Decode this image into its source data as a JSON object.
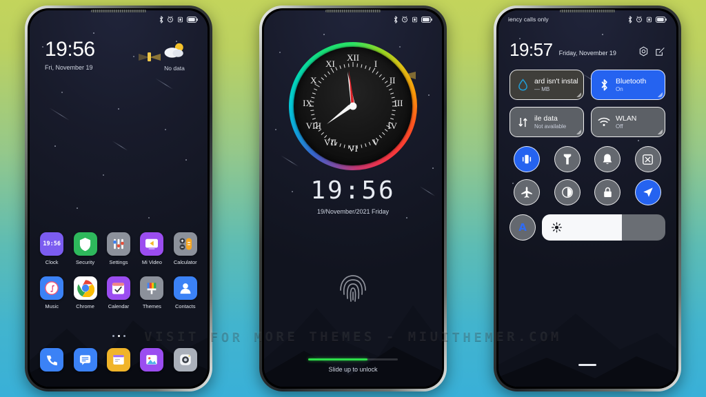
{
  "background": {
    "top_color": "#c3d45c",
    "bottom_color": "#39b0d8"
  },
  "watermark": {
    "text": "VISIT FOR MORE THEMES - MIUITHEMER.COM"
  },
  "phone1": {
    "status_bar": {
      "left_text": "",
      "icons": [
        "bluetooth-icon",
        "alarm-icon",
        "vibrate-icon",
        "battery-icon"
      ]
    },
    "clock": {
      "time": "19:56",
      "date": "Fri, November 19"
    },
    "weather": {
      "icon": "partly-cloudy-icon",
      "label": "No data"
    },
    "apps_row1": [
      {
        "label": "Clock",
        "icon": "clock-app-icon",
        "bg": "#7b5cf0"
      },
      {
        "label": "Security",
        "icon": "shield-icon",
        "bg": "#2eb85c"
      },
      {
        "label": "Settings",
        "icon": "settings-bars-icon",
        "bg": "#8c919b"
      },
      {
        "label": "Mi Video",
        "icon": "video-play-icon",
        "bg": "#9b4df0"
      },
      {
        "label": "Calculator",
        "icon": "calculator-icon",
        "bg": "#8c919b"
      }
    ],
    "apps_row2": [
      {
        "label": "Music",
        "icon": "music-note-icon",
        "bg": "#3b82f6"
      },
      {
        "label": "Chrome",
        "icon": "chrome-icon",
        "bg": "#ffffff"
      },
      {
        "label": "Calendar",
        "icon": "calendar-icon",
        "bg": "#9b4df0"
      },
      {
        "label": "Themes",
        "icon": "themes-brush-icon",
        "bg": "#8c919b"
      },
      {
        "label": "Contacts",
        "icon": "contact-icon",
        "bg": "#3b82f6"
      }
    ],
    "dock": [
      {
        "label": "Phone",
        "icon": "phone-handset-icon",
        "bg": "#3b82f6"
      },
      {
        "label": "Messages",
        "icon": "message-lines-icon",
        "bg": "#3b82f6"
      },
      {
        "label": "Notes",
        "icon": "notes-icon",
        "bg": "#f0b429"
      },
      {
        "label": "Gallery",
        "icon": "gallery-photo-icon",
        "bg": "#9b4df0"
      },
      {
        "label": "Camera",
        "icon": "camera-lens-icon",
        "bg": "#aab0ba"
      }
    ],
    "page_dots": {
      "count": 3,
      "active_index": 1
    }
  },
  "phone2": {
    "status_bar": {
      "icons": [
        "bluetooth-icon",
        "alarm-icon",
        "vibrate-icon",
        "battery-icon"
      ]
    },
    "analog_clock": {
      "numerals": [
        "I",
        "II",
        "III",
        "IV",
        "V",
        "VI",
        "VII",
        "VIII",
        "IX",
        "X",
        "XI",
        "XII"
      ],
      "hour_angle_deg": 236,
      "minute_angle_deg": 336,
      "second_angle_deg": 348,
      "ring_style": "rainbow-gradient",
      "hand_colors": {
        "hour": "#ffffff",
        "minute": "#ffffff",
        "second": "#e11d25"
      }
    },
    "digital_time": "19:56",
    "digital_date": "19/November/2021   Friday",
    "fingerprint": {
      "icon": "fingerprint-icon"
    },
    "slide_hint": "Slide up  to unlock",
    "slide_progress_percent": 66,
    "slide_color": "#2ee04a"
  },
  "phone3": {
    "status_bar": {
      "left_text": "iency calls only",
      "icons": [
        "bluetooth-icon",
        "alarm-icon",
        "vibrate-icon",
        "battery-icon"
      ]
    },
    "time": "19:57",
    "date": "Friday, November 19",
    "actions": [
      {
        "name": "settings-gear-icon"
      },
      {
        "name": "edit-icon"
      }
    ],
    "tiles": [
      {
        "title": "ard isn't instal",
        "subtitle": "— MB",
        "icon": "data-drop-icon",
        "state": "off",
        "style": "dim"
      },
      {
        "title": "Bluetooth",
        "subtitle": "On",
        "icon": "bluetooth-icon",
        "state": "on",
        "style": "blue"
      },
      {
        "title": "ile data",
        "subtitle": "Not available",
        "icon": "mobile-data-icon",
        "state": "off",
        "style": "grey"
      },
      {
        "title": "WLAN",
        "subtitle": "Off",
        "icon": "wifi-icon",
        "state": "off",
        "style": "grey"
      }
    ],
    "toggles": [
      {
        "name": "vibrate-toggle",
        "icon": "vibrate-icon",
        "state": "on"
      },
      {
        "name": "flashlight-toggle",
        "icon": "flashlight-icon",
        "state": "off"
      },
      {
        "name": "dnd-toggle",
        "icon": "bell-icon",
        "state": "off"
      },
      {
        "name": "screenshot-toggle",
        "icon": "screenshot-icon",
        "state": "off"
      },
      {
        "name": "airplane-toggle",
        "icon": "airplane-icon",
        "state": "off"
      },
      {
        "name": "darkmode-toggle",
        "icon": "contrast-icon",
        "state": "off"
      },
      {
        "name": "rotation-toggle",
        "icon": "lock-icon",
        "state": "off"
      },
      {
        "name": "location-toggle",
        "icon": "location-arrow-icon",
        "state": "on"
      }
    ],
    "auto_brightness_label": "A",
    "brightness_percent": 65
  }
}
